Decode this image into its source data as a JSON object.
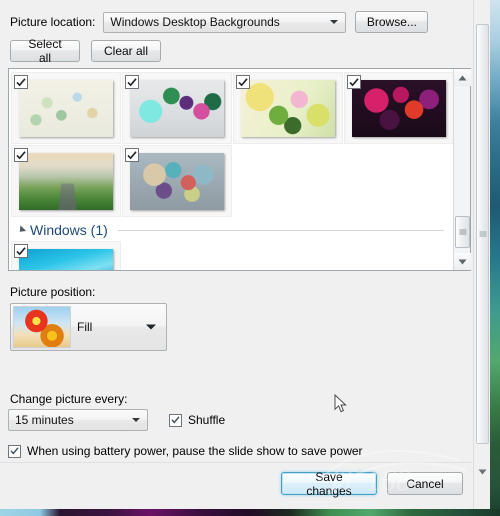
{
  "dialog": {
    "picture_location_label": "Picture location:",
    "picture_location_value": "Windows Desktop Backgrounds",
    "browse_label": "Browse...",
    "select_all_label": "Select all",
    "clear_all_label": "Clear all",
    "picture_position_label": "Picture position:",
    "picture_position_value": "Fill",
    "change_picture_label": "Change picture every:",
    "change_picture_value": "15 minutes",
    "shuffle_label": "Shuffle",
    "shuffle_checked": true,
    "battery_label": "When using battery power, pause the slide show to save power",
    "battery_checked": true,
    "save_label": "Save changes",
    "cancel_label": "Cancel"
  },
  "group": {
    "label": "Windows (1)",
    "expanded": true
  },
  "thumbnails": [
    {
      "name": "thumb-harmony-1",
      "art": "art-a",
      "checked": true
    },
    {
      "name": "thumb-harmony-2",
      "art": "art-b",
      "checked": true
    },
    {
      "name": "thumb-harmony-3",
      "art": "art-c",
      "checked": true
    },
    {
      "name": "thumb-harmony-4",
      "art": "art-d",
      "checked": true
    },
    {
      "name": "thumb-harmony-5",
      "art": "art-e",
      "checked": true
    },
    {
      "name": "thumb-harmony-6",
      "art": "art-f",
      "checked": true
    }
  ],
  "windows_group_thumbnails": [
    {
      "name": "thumb-windows-1",
      "art": "art-win",
      "checked": true
    }
  ],
  "icons": {
    "dropdown": "chevron-down-icon",
    "checkmark": "checkmark-icon",
    "scroll_up": "scroll-up-arrow-icon",
    "scroll_down": "scroll-down-arrow-icon",
    "group_collapse": "triangle-collapse-icon",
    "cursor": "mouse-cursor-icon"
  },
  "colors": {
    "dialog_bg": "#f0f0f0",
    "list_bg": "#ffffff",
    "group_text": "#1c4a7a",
    "default_button_border": "#4a9fc4"
  },
  "watermark": {
    "text": "IT168"
  }
}
